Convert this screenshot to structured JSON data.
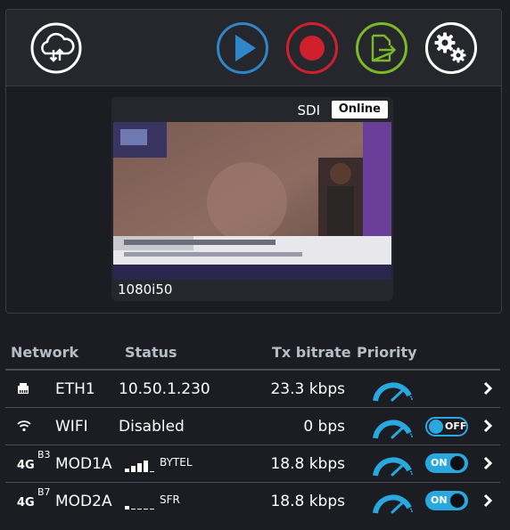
{
  "toolbar": {
    "buttons": [
      {
        "icon": "cloud-transfer-icon",
        "color": "#ffffff"
      },
      {
        "icon": "play-icon",
        "color": "#2f86c9"
      },
      {
        "icon": "record-icon",
        "color": "#d0202e"
      },
      {
        "icon": "export-file-icon",
        "color": "#7cb928"
      },
      {
        "icon": "settings-gears-icon",
        "color": "#ffffff"
      }
    ]
  },
  "preview": {
    "source": "SDI",
    "status": "Online",
    "resolution": "1080i50"
  },
  "network": {
    "headers": {
      "network": "Network",
      "status": "Status",
      "tx_bitrate": "Tx bitrate",
      "priority": "Priority"
    },
    "rows": [
      {
        "icon": "ethernet-icon",
        "name": "ETH1",
        "status": "10.50.1.230",
        "tx_bitrate": "23.3 kbps",
        "toggle": null
      },
      {
        "icon": "wifi-icon",
        "name": "WIFI",
        "status": "Disabled",
        "tx_bitrate": "0 bps",
        "toggle": "OFF"
      },
      {
        "tech": "4G",
        "band": "B3",
        "name": "MOD1A",
        "signal_bars": 4,
        "carrier": "BYTEL",
        "tx_bitrate": "18.8 kbps",
        "toggle": "ON"
      },
      {
        "tech": "4G",
        "band": "B7",
        "name": "MOD2A",
        "signal_bars": 1,
        "carrier": "SFR",
        "tx_bitrate": "18.8 kbps",
        "toggle": "ON"
      }
    ]
  },
  "colors": {
    "accent": "#29a8e0",
    "background": "#1b1d23",
    "toolbar": "#26272d"
  }
}
